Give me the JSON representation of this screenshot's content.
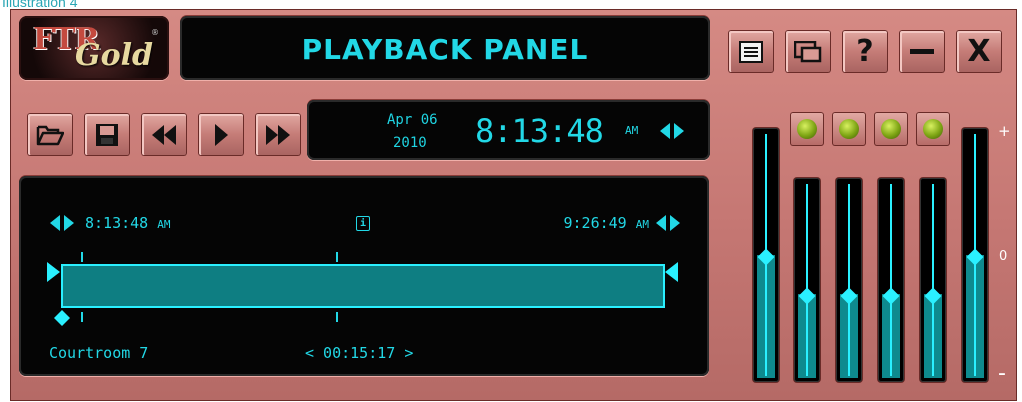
{
  "caption": "Illustration 4",
  "logo": {
    "primary": "FTR",
    "secondary": "Gold",
    "mark": "®"
  },
  "title": "PLAYBACK PANEL",
  "window_buttons": [
    {
      "name": "menu-icon",
      "glyph": "≡"
    },
    {
      "name": "window-toggle-icon",
      "glyph": "▭"
    },
    {
      "name": "help-icon",
      "glyph": "?"
    },
    {
      "name": "minimize-icon",
      "glyph": "—"
    },
    {
      "name": "close-icon",
      "glyph": "X"
    }
  ],
  "transport": [
    "folder-open-icon",
    "save-icon",
    "rewind-icon",
    "play-icon",
    "fast-forward-icon"
  ],
  "clock": {
    "date_line1": "Apr 06",
    "date_line2": "2010",
    "time": "8:13:48",
    "ampm": "AM"
  },
  "timeline": {
    "start_time": "8:13:48",
    "start_ampm": "AM",
    "end_time": "9:26:49",
    "end_ampm": "AM",
    "info_glyph": "i",
    "room": "Courtroom 7",
    "duration": "< 00:15:17 >"
  },
  "mixer": {
    "leds": 4,
    "channel_levels": [
      0.5,
      0.43,
      0.43,
      0.43,
      0.43,
      0.5
    ],
    "marks": {
      "plus": "+",
      "zero": "0",
      "minus": "-"
    }
  },
  "colors": {
    "accent": "#22d8e6",
    "panel": "#c57773"
  }
}
